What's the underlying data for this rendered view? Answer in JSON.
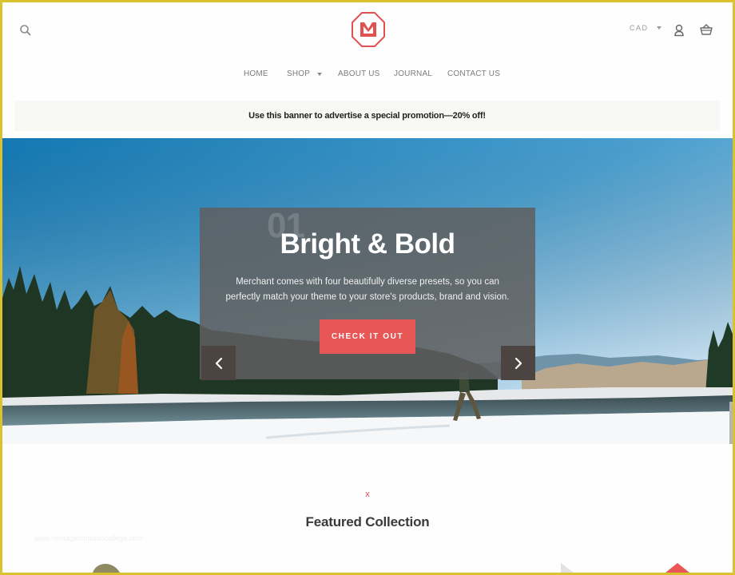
{
  "header": {
    "search_icon": "search-icon",
    "logo_letter": "M",
    "currency": "CAD",
    "account_icon": "user-icon",
    "cart_icon": "basket-icon",
    "brand_color": "#e0514f"
  },
  "nav": {
    "items": [
      {
        "label": "HOME"
      },
      {
        "label": "SHOP",
        "has_dropdown": true
      },
      {
        "label": "ABOUT US"
      },
      {
        "label": "JOURNAL"
      },
      {
        "label": "CONTACT US"
      }
    ]
  },
  "promo": {
    "text": "Use this banner to advertise a special promotion—20% off!"
  },
  "hero": {
    "slide_number": "01",
    "title": "Bright & Bold",
    "description": "Merchant comes with four beautifully diverse presets, so you can perfectly match your theme to your store's products, brand and vision.",
    "cta_label": "CHECK IT OUT",
    "cta_color": "#e85656",
    "prev_icon": "chevron-left-icon",
    "next_icon": "chevron-right-icon"
  },
  "featured": {
    "divider_glyph": "x",
    "title": "Featured Collection"
  },
  "watermark": "www.heritagechristiancollege.com"
}
